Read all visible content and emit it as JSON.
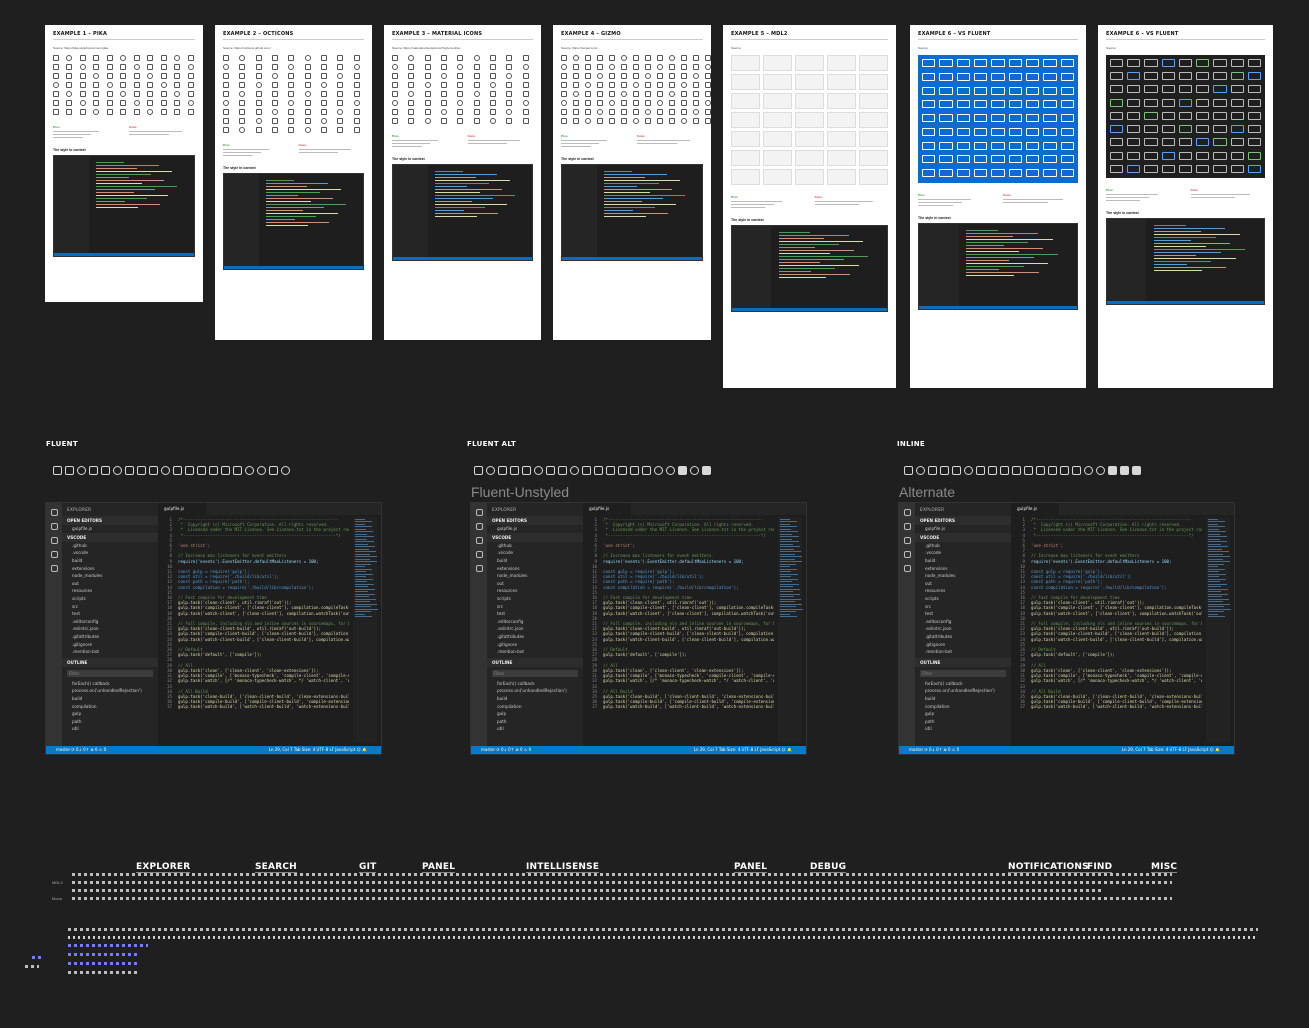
{
  "examples": [
    {
      "title": "EXAMPLE 1 – PIKA",
      "source": "Source: https://pika.style/icons/mono/pika"
    },
    {
      "title": "EXAMPLE 2 – OCTICONS",
      "source": "Source: https://octicons.github.com/"
    },
    {
      "title": "EXAMPLE 3 – MATERIAL ICONS",
      "source": "Source: https://material.io/tools/icons/?style=outline"
    },
    {
      "title": "EXAMPLE 4 – GIZMO",
      "source": "Source: https://iconjar.com/..."
    },
    {
      "title": "EXAMPLE 5 – MDL2",
      "source": "Source:"
    },
    {
      "title": "EXAMPLE 6 – VS FLUENT",
      "source": "Source:"
    },
    {
      "title": "EXAMPLE 6 – VS FLUENT",
      "source": "Source:"
    }
  ],
  "sheet_labels": {
    "pros": "Pros",
    "cons": "Cons",
    "style": "The style in context"
  },
  "variants": [
    {
      "label": "FLUENT",
      "name": ""
    },
    {
      "label": "FLUENT ALT",
      "name": "Fluent-Unstyled"
    },
    {
      "label": "INLINE",
      "name": "Alternate"
    }
  ],
  "editor": {
    "explorer_header": "EXPLORER",
    "open_editors": "OPEN EDITORS",
    "open_file": "gulpfile.js",
    "workspace": "VSCODE",
    "tree": [
      ".github",
      ".vscode",
      "build",
      "extensions",
      "node_modules",
      "out",
      "resources",
      "scripts",
      "src",
      "test",
      ".editorconfig",
      ".eslintrc.json",
      ".gitattributes",
      ".gitignore",
      ".mention-bot"
    ],
    "outline": "OUTLINE",
    "filter_placeholder": "Filter",
    "outline_items": [
      "forEach() callback",
      "process.on('unhandledRejection')",
      "build",
      "compilation",
      "gulp",
      "path",
      "util"
    ],
    "tab": "gulpfile.js",
    "code_lines": [
      {
        "n": "1",
        "t": "/*---------------------------------------------------------------",
        "c": "cm"
      },
      {
        "n": "2",
        "t": " *  Copyright (c) Microsoft Corporation. All rights reserved.",
        "c": "cm"
      },
      {
        "n": "3",
        "t": " *  Licensed under the MIT License. See License.txt in the project root",
        "c": "cm"
      },
      {
        "n": "4",
        "t": " *--------------------------------------------------------------*/",
        "c": "cm"
      },
      {
        "n": "5",
        "t": "",
        "c": ""
      },
      {
        "n": "6",
        "t": "'use strict';",
        "c": "st"
      },
      {
        "n": "7",
        "t": "",
        "c": ""
      },
      {
        "n": "8",
        "t": "// Increase max listeners for event emitters",
        "c": "cm"
      },
      {
        "n": "9",
        "t": "require('events').EventEmitter.defaultMaxListeners = 100;",
        "c": "vr"
      },
      {
        "n": "10",
        "t": "",
        "c": ""
      },
      {
        "n": "11",
        "t": "const gulp = require('gulp');",
        "c": "kw"
      },
      {
        "n": "12",
        "t": "const util = require('./build/lib/util');",
        "c": "kw"
      },
      {
        "n": "13",
        "t": "const path = require('path');",
        "c": "kw"
      },
      {
        "n": "14",
        "t": "const compilation = require('./build/lib/compilation');",
        "c": "kw"
      },
      {
        "n": "15",
        "t": "",
        "c": ""
      },
      {
        "n": "16",
        "t": "// Fast compile for development time",
        "c": "cm"
      },
      {
        "n": "17",
        "t": "gulp.task('clean-client', util.rimraf('out'));",
        "c": "fn"
      },
      {
        "n": "18",
        "t": "gulp.task('compile-client', ['clean-client'], compilation.compileTask('",
        "c": "fn"
      },
      {
        "n": "19",
        "t": "gulp.task('watch-client', ['clean-client'], compilation.watchTask('out',",
        "c": "fn"
      },
      {
        "n": "20",
        "t": "",
        "c": ""
      },
      {
        "n": "21",
        "t": "// Full compile, including nls and inline sources in sourcemaps, for bui",
        "c": "cm"
      },
      {
        "n": "22",
        "t": "gulp.task('clean-client-build', util.rimraf('out-build'));",
        "c": "fn"
      },
      {
        "n": "23",
        "t": "gulp.task('compile-client-build', ['clean-client-build'], compilation.co",
        "c": "fn"
      },
      {
        "n": "24",
        "t": "gulp.task('watch-client-build', ['clean-client-build'], compilation.watc",
        "c": "fn"
      },
      {
        "n": "25",
        "t": "",
        "c": ""
      },
      {
        "n": "26",
        "t": "// Default",
        "c": "cm"
      },
      {
        "n": "27",
        "t": "gulp.task('default', ['compile']);",
        "c": "fn"
      },
      {
        "n": "28",
        "t": "",
        "c": ""
      },
      {
        "n": "29",
        "t": "// All",
        "c": "cm"
      },
      {
        "n": "30",
        "t": "gulp.task('clean', ['clean-client', 'clean-extensions']);",
        "c": "fn"
      },
      {
        "n": "31",
        "t": "gulp.task('compile', ['monaco-typecheck', 'compile-client', 'compile-ext",
        "c": "fn"
      },
      {
        "n": "32",
        "t": "gulp.task('watch', [/* 'monaco-typecheck-watch', */ 'watch-client', 'wat",
        "c": "fn"
      },
      {
        "n": "33",
        "t": "",
        "c": ""
      },
      {
        "n": "34",
        "t": "// All Build",
        "c": "cm"
      },
      {
        "n": "35",
        "t": "gulp.task('clean-build', ['clean-client-build', 'clean-extensions-build'",
        "c": "fn"
      },
      {
        "n": "36",
        "t": "gulp.task('compile-build', ['compile-client-build', 'compile-extensions-",
        "c": "fn"
      },
      {
        "n": "37",
        "t": "gulp.task('watch-build', ['watch-client-build', 'watch-extensions-build'",
        "c": "fn"
      }
    ],
    "status_left": "master  ⟳ 0↓ 0↑  ⊗ 0 ⚠ 0",
    "status_right": "Ln 29, Col 7   Tab Size: 4   UTF-8   LF   JavaScript  ☺  🔔"
  },
  "categories": [
    "EXPLORER",
    "SEARCH",
    "GIT",
    "PANEL",
    "INTELLISENSE",
    "PANEL",
    "DEBUG",
    "NOTIFICATIONS",
    "FIND",
    "MISC"
  ],
  "row_labels": [
    "MDL2",
    "Mono"
  ],
  "colors": {
    "background": "#1f1f1f",
    "status_bar": "#007acc",
    "fluent_blue": "#0b6bd0",
    "accent_purple": "#7a7aff"
  }
}
